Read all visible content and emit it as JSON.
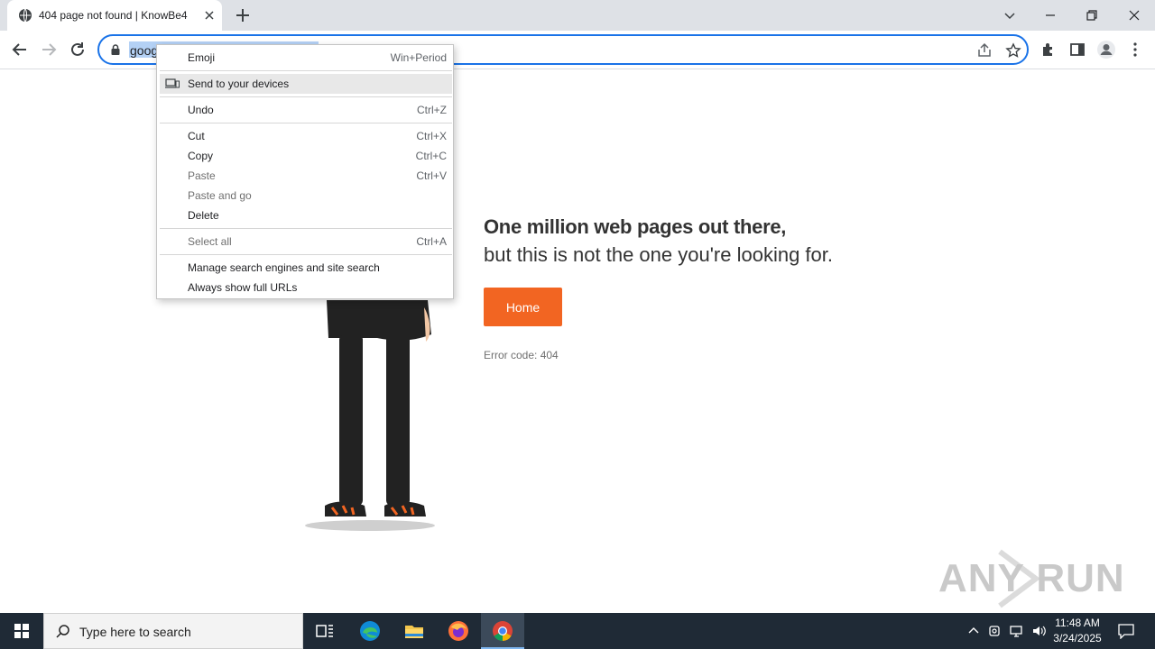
{
  "browser": {
    "tab_title": "404 page not found | KnowBe4",
    "url_text": "goog",
    "icons": {
      "favicon": "globe-icon",
      "tab_close": "close-icon",
      "new_tab": "plus-icon",
      "tab_search": "chevron-down-icon",
      "minimize": "minimize-icon",
      "restore": "restore-icon",
      "close": "close-icon",
      "back": "back-arrow-icon",
      "forward": "forward-arrow-icon",
      "reload": "reload-icon",
      "lock": "lock-icon",
      "share": "share-icon",
      "bookmark": "star-icon",
      "extensions": "puzzle-icon",
      "side_panel": "side-panel-icon",
      "profile": "avatar-icon",
      "menu": "kebab-menu-icon"
    },
    "colors": {
      "accent": "#1a73e8",
      "tabstrip": "#dee1e6"
    }
  },
  "context_menu": {
    "items": [
      {
        "label": "Emoji",
        "shortcut": "Win+Period"
      },
      {
        "label": "Send to your devices",
        "shortcut": ""
      },
      {
        "label": "Undo",
        "shortcut": "Ctrl+Z"
      },
      {
        "label": "Cut",
        "shortcut": "Ctrl+X"
      },
      {
        "label": "Copy",
        "shortcut": "Ctrl+C"
      },
      {
        "label": "Paste",
        "shortcut": "Ctrl+V"
      },
      {
        "label": "Paste and go",
        "shortcut": ""
      },
      {
        "label": "Delete",
        "shortcut": ""
      },
      {
        "label": "Select all",
        "shortcut": "Ctrl+A"
      },
      {
        "label": "Manage search engines and site search",
        "shortcut": ""
      },
      {
        "label": "Always show full URLs",
        "shortcut": ""
      }
    ]
  },
  "page": {
    "heading_line1": "One million web pages out there,",
    "heading_line2": "but this is not the one you're looking for.",
    "home_button": "Home",
    "error_code": "Error code: 404",
    "watermark": "ANY RUN",
    "colors": {
      "button": "#f26522"
    }
  },
  "taskbar": {
    "search_placeholder": "Type here to search",
    "time": "11:48 AM",
    "date": "3/24/2025",
    "apps": [
      "task-view-icon",
      "edge-icon",
      "file-explorer-icon",
      "firefox-icon",
      "chrome-icon"
    ]
  }
}
